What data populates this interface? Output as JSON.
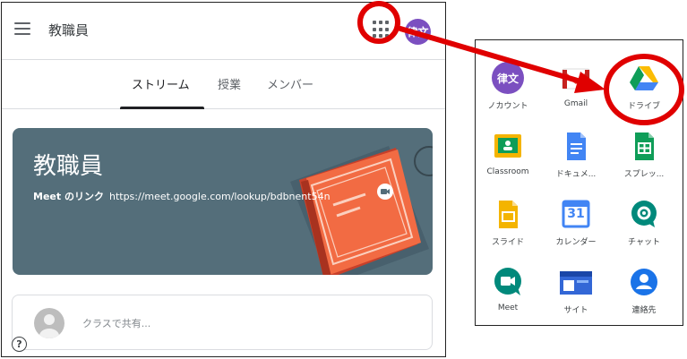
{
  "header": {
    "title": "教職員",
    "avatar_text": "律文"
  },
  "tabs": [
    "ストリーム",
    "授業",
    "メンバー"
  ],
  "banner": {
    "title": "教職員",
    "meet_label": "Meet のリンク",
    "meet_url": "https://meet.google.com/lookup/bdbnent54n"
  },
  "share": {
    "placeholder": "クラスで共有..."
  },
  "help": {
    "symbol": "?"
  },
  "launcher": {
    "apps": [
      {
        "label": "ノカウント",
        "icon": "account-avatar-icon",
        "avatar_text": "律文"
      },
      {
        "label": "Gmail",
        "icon": "gmail-icon"
      },
      {
        "label": "ドライブ",
        "icon": "drive-icon"
      },
      {
        "label": "Classroom",
        "icon": "classroom-icon"
      },
      {
        "label": "ドキュメ...",
        "icon": "docs-icon"
      },
      {
        "label": "スプレッ...",
        "icon": "sheets-icon"
      },
      {
        "label": "スライド",
        "icon": "slides-icon"
      },
      {
        "label": "カレンダー",
        "icon": "calendar-icon",
        "day": "31"
      },
      {
        "label": "チャット",
        "icon": "chat-icon"
      },
      {
        "label": "Meet",
        "icon": "meet-icon"
      },
      {
        "label": "サイト",
        "icon": "sites-icon"
      },
      {
        "label": "連絡先",
        "icon": "contacts-icon"
      }
    ]
  },
  "colors": {
    "banner": "#546e7a",
    "avatar": "#7b4fc0",
    "annotation": "#e00000"
  }
}
